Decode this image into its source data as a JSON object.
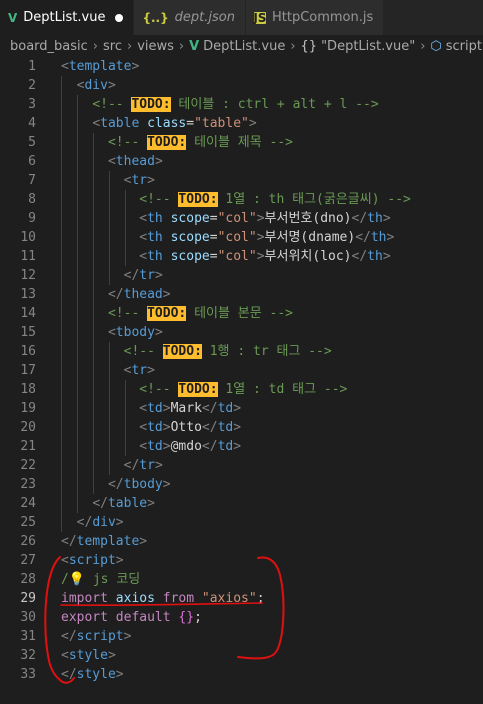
{
  "tabs": [
    {
      "label": "DeptList.vue",
      "icon": "vue-icon",
      "modified": true
    },
    {
      "label": "dept.json",
      "icon": "json-icon",
      "modified": false
    },
    {
      "label": "HttpCommon.js",
      "icon": "js-icon",
      "modified": false
    }
  ],
  "breadcrumb": {
    "items": [
      "board_basic",
      "src",
      "views",
      "DeptList.vue",
      "\"DeptList.vue\"",
      "script"
    ]
  },
  "editor": {
    "current_line": 29,
    "line_numbers": [
      "1",
      "2",
      "3",
      "4",
      "5",
      "6",
      "7",
      "8",
      "9",
      "10",
      "11",
      "12",
      "13",
      "14",
      "15",
      "16",
      "17",
      "18",
      "19",
      "20",
      "21",
      "22",
      "23",
      "24",
      "25",
      "26",
      "27",
      "28",
      "29",
      "30",
      "31",
      "32",
      "33"
    ],
    "todo": "TODO:",
    "comments": {
      "l3": " 테이블 : ctrl + alt + l ",
      "l5": " 테이블 제목 ",
      "l8": " 1열 : th 태그(굵은글씨) ",
      "l13": " 테이블 본문 ",
      "l15": " 1행 : tr 태그 ",
      "l17": " 1열 : td 태그 ",
      "l28": "js 코딩"
    },
    "cells": {
      "th1": "부서번호(dno)",
      "th2": "부서명(dname)",
      "th3": "부서위치(loc)",
      "td1": "Mark",
      "td2": "Otto",
      "td3": "@mdo"
    },
    "strings": {
      "table_class": "\"table\"",
      "col": "\"col\"",
      "axios": "\"axios\""
    }
  },
  "colors": {
    "background": "#1e1e1e",
    "tag": "#569cd6",
    "comment": "#6a9955",
    "string": "#ce9178",
    "attribute": "#9cdcfe",
    "keyword": "#c586c0",
    "todo_highlight": "#ffbd2e",
    "annotation_ink": "#e01010"
  }
}
